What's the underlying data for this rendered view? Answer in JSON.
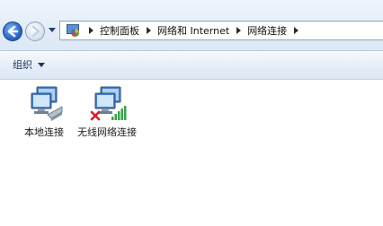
{
  "nav": {
    "breadcrumb": [
      {
        "label": "控制面板"
      },
      {
        "label": "网络和 Internet"
      },
      {
        "label": "网络连接"
      }
    ]
  },
  "toolbar": {
    "organize_label": "组织"
  },
  "connections": [
    {
      "label": "本地连接",
      "icon": "local-area-connection-icon",
      "status": "connected"
    },
    {
      "label": "无线网络连接",
      "icon": "wireless-network-connection-icon",
      "status": "disconnected"
    }
  ],
  "colors": {
    "accent": "#2a6fd0",
    "toolbar_text": "#1f3560",
    "error_red": "#d4202a",
    "signal_green": "#3aa34a"
  }
}
